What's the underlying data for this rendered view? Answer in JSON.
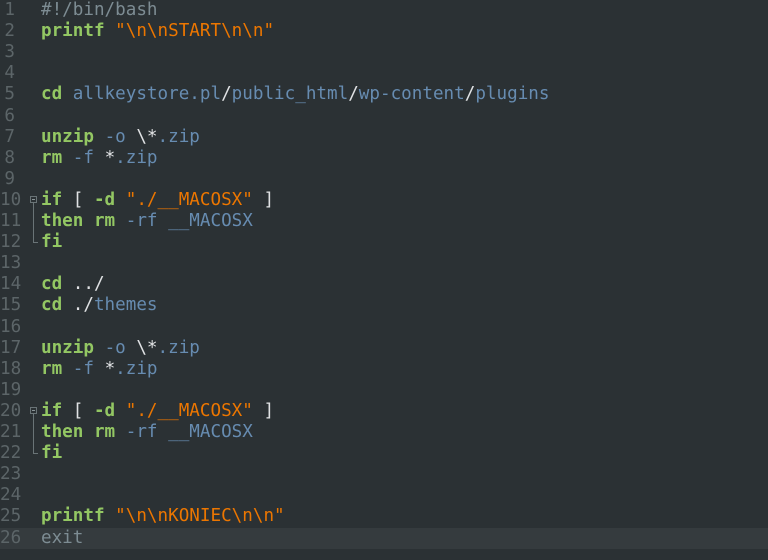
{
  "editor": {
    "language": "bash",
    "current_line": 26,
    "colors": {
      "background": "#2b3134",
      "keyword": "#93c763",
      "string": "#ec7600",
      "argument": "#678cb1",
      "plain": "#e0e2e4",
      "comment": "#7d8c93",
      "line_number": "#5c6568"
    },
    "lines": [
      {
        "n": "1",
        "fold": "",
        "tokens": [
          {
            "t": "#!/bin/bash",
            "c": "comment"
          }
        ]
      },
      {
        "n": "2",
        "fold": "",
        "tokens": [
          {
            "t": "printf",
            "c": "kw"
          },
          {
            "t": " ",
            "c": "plain"
          },
          {
            "t": "\"\\n\\nSTART\\n\\n\"",
            "c": "str"
          }
        ]
      },
      {
        "n": "3",
        "fold": "",
        "tokens": []
      },
      {
        "n": "4",
        "fold": "",
        "tokens": []
      },
      {
        "n": "5",
        "fold": "",
        "tokens": [
          {
            "t": "cd",
            "c": "kw"
          },
          {
            "t": " ",
            "c": "plain"
          },
          {
            "t": "allkeystore.pl",
            "c": "arg"
          },
          {
            "t": "/",
            "c": "plain"
          },
          {
            "t": "public_html",
            "c": "arg"
          },
          {
            "t": "/",
            "c": "plain"
          },
          {
            "t": "wp-content",
            "c": "arg"
          },
          {
            "t": "/",
            "c": "plain"
          },
          {
            "t": "plugins",
            "c": "arg"
          }
        ]
      },
      {
        "n": "6",
        "fold": "",
        "tokens": []
      },
      {
        "n": "7",
        "fold": "",
        "tokens": [
          {
            "t": "unzip",
            "c": "kw"
          },
          {
            "t": " ",
            "c": "plain"
          },
          {
            "t": "-o",
            "c": "arg"
          },
          {
            "t": " ",
            "c": "plain"
          },
          {
            "t": "\\*",
            "c": "plain"
          },
          {
            "t": ".zip",
            "c": "arg"
          }
        ]
      },
      {
        "n": "8",
        "fold": "",
        "tokens": [
          {
            "t": "rm",
            "c": "kw"
          },
          {
            "t": " ",
            "c": "plain"
          },
          {
            "t": "-f",
            "c": "arg"
          },
          {
            "t": " ",
            "c": "plain"
          },
          {
            "t": "*",
            "c": "plain"
          },
          {
            "t": ".zip",
            "c": "arg"
          }
        ]
      },
      {
        "n": "9",
        "fold": "",
        "tokens": []
      },
      {
        "n": "10",
        "fold": "start",
        "tokens": [
          {
            "t": "if",
            "c": "kw"
          },
          {
            "t": " [ ",
            "c": "plain"
          },
          {
            "t": "-d",
            "c": "kw"
          },
          {
            "t": " ",
            "c": "plain"
          },
          {
            "t": "\"./__MACOSX\"",
            "c": "str"
          },
          {
            "t": " ]",
            "c": "plain"
          }
        ]
      },
      {
        "n": "11",
        "fold": "mid",
        "tokens": [
          {
            "t": "then",
            "c": "kw"
          },
          {
            "t": " ",
            "c": "plain"
          },
          {
            "t": "rm",
            "c": "kw"
          },
          {
            "t": " ",
            "c": "plain"
          },
          {
            "t": "-rf",
            "c": "arg"
          },
          {
            "t": " ",
            "c": "plain"
          },
          {
            "t": "__MACOSX",
            "c": "arg"
          }
        ]
      },
      {
        "n": "12",
        "fold": "end",
        "tokens": [
          {
            "t": "fi",
            "c": "kw"
          }
        ]
      },
      {
        "n": "13",
        "fold": "",
        "tokens": []
      },
      {
        "n": "14",
        "fold": "",
        "tokens": [
          {
            "t": "cd",
            "c": "kw"
          },
          {
            "t": " ",
            "c": "plain"
          },
          {
            "t": "../",
            "c": "plain"
          }
        ]
      },
      {
        "n": "15",
        "fold": "",
        "tokens": [
          {
            "t": "cd",
            "c": "kw"
          },
          {
            "t": " ",
            "c": "plain"
          },
          {
            "t": "./",
            "c": "plain"
          },
          {
            "t": "themes",
            "c": "arg"
          }
        ]
      },
      {
        "n": "16",
        "fold": "",
        "tokens": []
      },
      {
        "n": "17",
        "fold": "",
        "tokens": [
          {
            "t": "unzip",
            "c": "kw"
          },
          {
            "t": " ",
            "c": "plain"
          },
          {
            "t": "-o",
            "c": "arg"
          },
          {
            "t": " ",
            "c": "plain"
          },
          {
            "t": "\\*",
            "c": "plain"
          },
          {
            "t": ".zip",
            "c": "arg"
          }
        ]
      },
      {
        "n": "18",
        "fold": "",
        "tokens": [
          {
            "t": "rm",
            "c": "kw"
          },
          {
            "t": " ",
            "c": "plain"
          },
          {
            "t": "-f",
            "c": "arg"
          },
          {
            "t": " ",
            "c": "plain"
          },
          {
            "t": "*",
            "c": "plain"
          },
          {
            "t": ".zip",
            "c": "arg"
          }
        ]
      },
      {
        "n": "19",
        "fold": "",
        "tokens": []
      },
      {
        "n": "20",
        "fold": "start",
        "tokens": [
          {
            "t": "if",
            "c": "kw"
          },
          {
            "t": " [ ",
            "c": "plain"
          },
          {
            "t": "-d",
            "c": "kw"
          },
          {
            "t": " ",
            "c": "plain"
          },
          {
            "t": "\"./__MACOSX\"",
            "c": "str"
          },
          {
            "t": " ]",
            "c": "plain"
          }
        ]
      },
      {
        "n": "21",
        "fold": "mid",
        "tokens": [
          {
            "t": "then",
            "c": "kw"
          },
          {
            "t": " ",
            "c": "plain"
          },
          {
            "t": "rm",
            "c": "kw"
          },
          {
            "t": " ",
            "c": "plain"
          },
          {
            "t": "-rf",
            "c": "arg"
          },
          {
            "t": " ",
            "c": "plain"
          },
          {
            "t": "__MACOSX",
            "c": "arg"
          }
        ]
      },
      {
        "n": "22",
        "fold": "end",
        "tokens": [
          {
            "t": "fi",
            "c": "kw"
          }
        ]
      },
      {
        "n": "23",
        "fold": "",
        "tokens": []
      },
      {
        "n": "24",
        "fold": "",
        "tokens": []
      },
      {
        "n": "25",
        "fold": "",
        "tokens": [
          {
            "t": "printf",
            "c": "kw"
          },
          {
            "t": " ",
            "c": "plain"
          },
          {
            "t": "\"\\n\\nKONIEC\\n\\n\"",
            "c": "str"
          }
        ]
      },
      {
        "n": "26",
        "fold": "",
        "tokens": [
          {
            "t": "exit",
            "c": "comment"
          }
        ]
      }
    ]
  }
}
